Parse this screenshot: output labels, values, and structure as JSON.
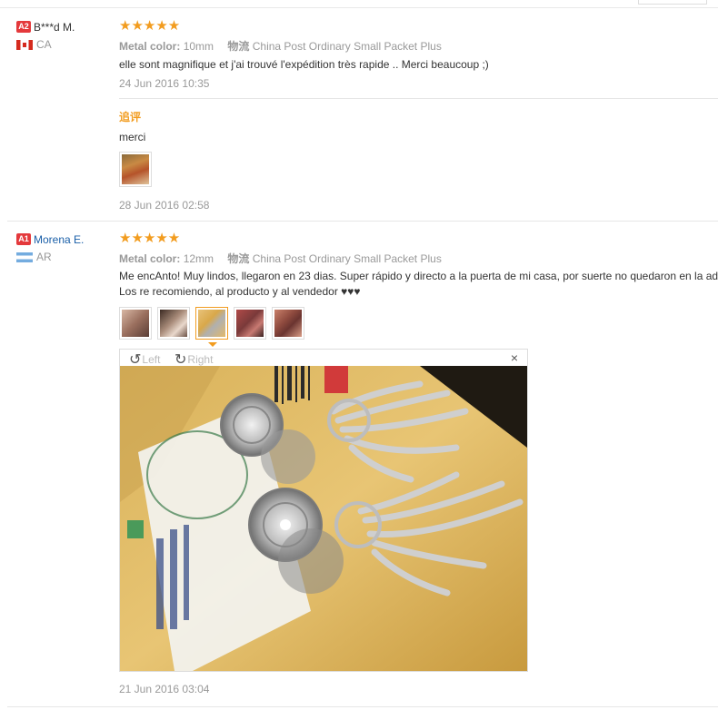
{
  "reviews": [
    {
      "level": "A2",
      "user": "B***d M.",
      "country": "CA",
      "rating": "★★★★★",
      "attr_key": "Metal color:",
      "attr_val": "10mm",
      "ship_key": "物流",
      "ship_val": "China Post Ordinary Small Packet Plus",
      "text": "elle sont magnifique et j'ai trouvé l'expédition très rapide .. Merci beaucoup ;)",
      "date": "24 Jun 2016 10:35",
      "followup": {
        "title": "追评",
        "text": "merci",
        "date": "28 Jun 2016 02:58"
      }
    },
    {
      "level": "A1",
      "user": "Morena E.",
      "country": "AR",
      "rating": "★★★★★",
      "attr_key": "Metal color:",
      "attr_val": "12mm",
      "ship_key": "物流",
      "ship_val": "China Post Ordinary Small Packet Plus",
      "text_line1": "Me encAnto! Muy lindos, llegaron en 23 dias. Super rápido y directo a la puerta de mi casa, por suerte no quedaron en la aduana",
      "text_line2": "Los re recomiendo, al producto y al vendedor ♥♥♥",
      "date": "21 Jun 2016 03:04"
    }
  ],
  "viewer": {
    "rotate_left": "Left",
    "rotate_right": "Right",
    "close": "×"
  },
  "colors": {
    "star": "#f29c1f",
    "badge": "#e4393c",
    "link": "#1a5fa8",
    "muted": "#999999"
  }
}
